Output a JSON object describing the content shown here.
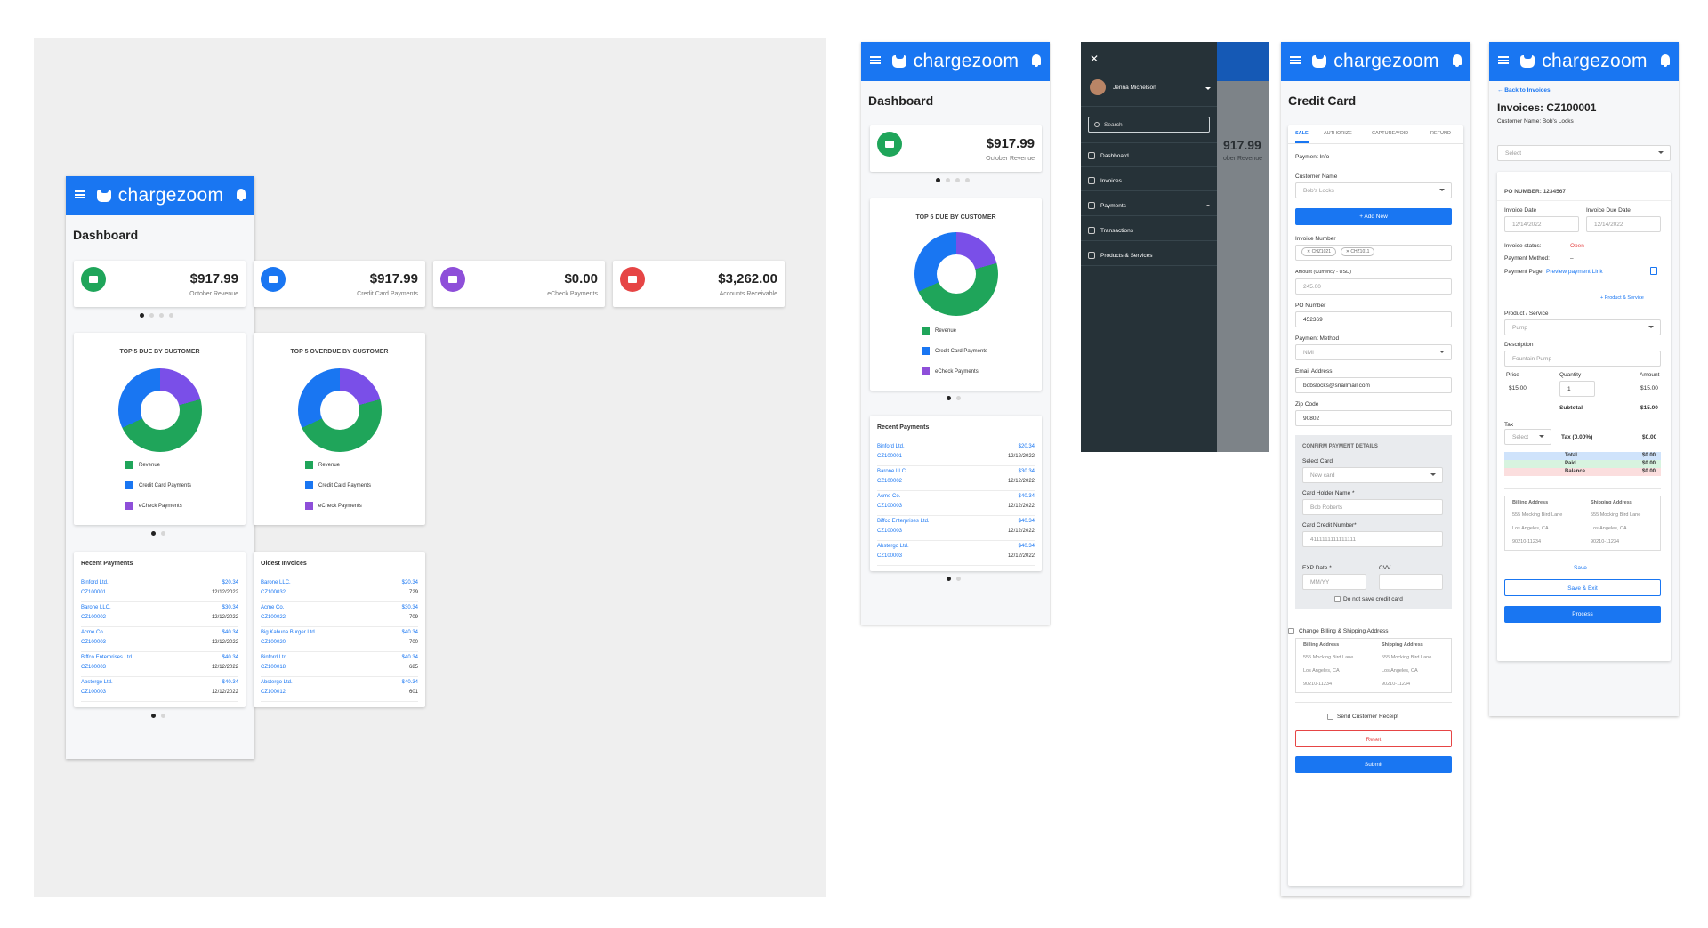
{
  "brand": {
    "name": "chargezoom",
    "color": "#1976f2"
  },
  "dashboard": {
    "title": "Dashboard",
    "stats": [
      {
        "amount": "$917.99",
        "label": "October Revenue",
        "color": "#1fa55a",
        "icon": "play-icon"
      },
      {
        "amount": "$917.99",
        "label": "Credit Card Payments",
        "color": "#1976f2",
        "icon": "card-icon"
      },
      {
        "amount": "$0.00",
        "label": "eCheck Payments",
        "color": "#8e4fd9",
        "icon": "check-icon"
      },
      {
        "amount": "$3,262.00",
        "label": "Accounts Receivable",
        "color": "#e64545",
        "icon": "calendar-icon"
      }
    ],
    "charts": [
      {
        "title": "TOP 5 DUE BY CUSTOMER"
      },
      {
        "title": "TOP 5 OVERDUE BY CUSTOMER"
      }
    ],
    "legend": [
      "Revenue",
      "Credit Card Payments",
      "eCheck Payments"
    ],
    "recent_payments": {
      "title": "Recent Payments",
      "rows": [
        {
          "name": "Binford Ltd.",
          "id": "CZ100001",
          "value": "$20.34",
          "date": "12/12/2022"
        },
        {
          "name": "Barone LLC.",
          "id": "CZ100002",
          "value": "$30.34",
          "date": "12/12/2022"
        },
        {
          "name": "Acme Co.",
          "id": "CZ100003",
          "value": "$40.34",
          "date": "12/12/2022"
        },
        {
          "name": "Biffco Enterprises Ltd.",
          "id": "CZ100003",
          "value": "$40.34",
          "date": "12/12/2022"
        },
        {
          "name": "Abstergo Ltd.",
          "id": "CZ100003",
          "value": "$40.34",
          "date": "12/12/2022"
        }
      ]
    },
    "oldest_invoices": {
      "title": "Oldest Invoices",
      "rows": [
        {
          "name": "Barone LLC.",
          "id": "CZ100032",
          "value": "$20.34",
          "date": "729"
        },
        {
          "name": "Acme Co.",
          "id": "CZ100022",
          "value": "$30.34",
          "date": "709"
        },
        {
          "name": "Big Kahuna Burger Ltd.",
          "id": "CZ100020",
          "value": "$40.34",
          "date": "700"
        },
        {
          "name": "Binford Ltd.",
          "id": "CZ100018",
          "value": "$40.34",
          "date": "685"
        },
        {
          "name": "Abstergo Ltd.",
          "id": "CZ100012",
          "value": "$40.34",
          "date": "601"
        }
      ]
    }
  },
  "drawer": {
    "user": "Jenna Michelson",
    "search_placeholder": "Search",
    "items": [
      "Dashboard",
      "Invoices",
      "Payments",
      "Transactions",
      "Products & Services"
    ],
    "bg_amount": "917.99",
    "bg_sub": "ober Revenue"
  },
  "credit_card": {
    "title": "Credit Card",
    "tabs": [
      "SALE",
      "AUTHORIZE",
      "CAPTURE/VOID",
      "REFUND"
    ],
    "payment_info": "Payment Info",
    "customer_name_label": "Customer Name",
    "customer_name": "Bob's Locks",
    "add_new": "+  Add New",
    "invoice_number_label": "Invoice Number",
    "invoice_tags": [
      "CHZ1021",
      "CHZ1011"
    ],
    "amount_label": "Amount (Currency - USD)",
    "amount": "245.00",
    "po_label": "PO Number",
    "po": "452369",
    "method_label": "Payment Method",
    "method": "NMI",
    "email_label": "Email Address",
    "email": "bobslocks@snailmail.com",
    "zip_label": "Zip Code",
    "zip": "90802",
    "confirm_title": "CONFIRM PAYMENT DETAILS",
    "select_card_label": "Select Card",
    "select_card": "New card",
    "holder_label": "Card Holder Name *",
    "holder": "Bob Roberts",
    "card_label": "Card Credit Number*",
    "card": "4111111111111111",
    "exp_label": "EXP Date *",
    "exp": "MM/YY",
    "cvv_label": "CVV",
    "no_save": "Do not save credit card",
    "change_addr": "Change Billing & Shipping Address",
    "billing_label": "Billing Address",
    "shipping_label": "Shipping Address",
    "addr_lines": [
      "555 Mocking Bird Lane",
      "Los Angeles, CA",
      "90210-11234"
    ],
    "send_receipt": "Send Customer Receipt",
    "reset": "Reset",
    "submit": "Submit"
  },
  "invoice": {
    "back": "← Back  to Invoices",
    "title": "Invoices: CZ100001",
    "customer": "Customer Name: Bob's Locks",
    "select": "Select",
    "po_number": "PO NUMBER: 1234567",
    "inv_date_label": "Invoice Date",
    "inv_date": "12/14/2022",
    "due_label": "Invoice Due Date",
    "due": "12/14/2022",
    "status_label": "Invoice status:",
    "status": "Open",
    "method_label": "Payment Method:",
    "method": "–",
    "page_label": "Payment Page:",
    "page_link": "Preview payment Link",
    "add_product": "+  Product & Service",
    "product_label": "Product / Service",
    "product": "Pump",
    "desc_label": "Description",
    "desc": "Fountain Pump",
    "price_label": "Price",
    "price": "$15.00",
    "qty_label": "Quantity",
    "qty": "1",
    "amount_label": "Amount",
    "amount": "$15.00",
    "subtotal_label": "Subtotal",
    "subtotal": "$15.00",
    "tax_label": "Tax",
    "tax_select": "Select",
    "tax_pct": "Tax (0.00%)",
    "tax": "$0.00",
    "total_label": "Total",
    "total": "$0.00",
    "paid_label": "Paid",
    "paid": "$0.00",
    "balance_label": "Balance",
    "balance": "$0.00",
    "save": "Save",
    "save_exit": "Save & Exit",
    "process": "Process"
  }
}
